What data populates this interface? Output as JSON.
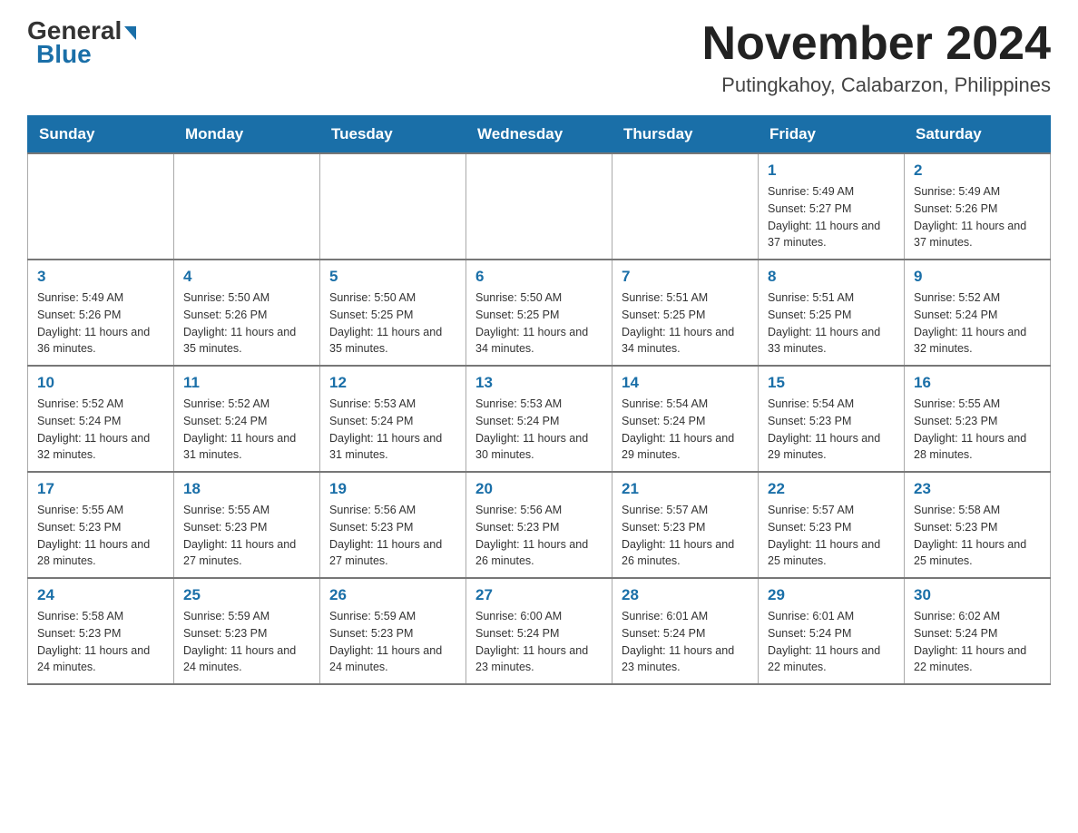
{
  "header": {
    "logo_general": "General",
    "logo_blue": "Blue",
    "month_title": "November 2024",
    "location": "Putingkahoy, Calabarzon, Philippines"
  },
  "days_of_week": [
    "Sunday",
    "Monday",
    "Tuesday",
    "Wednesday",
    "Thursday",
    "Friday",
    "Saturday"
  ],
  "weeks": [
    [
      {
        "day": "",
        "info": ""
      },
      {
        "day": "",
        "info": ""
      },
      {
        "day": "",
        "info": ""
      },
      {
        "day": "",
        "info": ""
      },
      {
        "day": "",
        "info": ""
      },
      {
        "day": "1",
        "info": "Sunrise: 5:49 AM\nSunset: 5:27 PM\nDaylight: 11 hours and 37 minutes."
      },
      {
        "day": "2",
        "info": "Sunrise: 5:49 AM\nSunset: 5:26 PM\nDaylight: 11 hours and 37 minutes."
      }
    ],
    [
      {
        "day": "3",
        "info": "Sunrise: 5:49 AM\nSunset: 5:26 PM\nDaylight: 11 hours and 36 minutes."
      },
      {
        "day": "4",
        "info": "Sunrise: 5:50 AM\nSunset: 5:26 PM\nDaylight: 11 hours and 35 minutes."
      },
      {
        "day": "5",
        "info": "Sunrise: 5:50 AM\nSunset: 5:25 PM\nDaylight: 11 hours and 35 minutes."
      },
      {
        "day": "6",
        "info": "Sunrise: 5:50 AM\nSunset: 5:25 PM\nDaylight: 11 hours and 34 minutes."
      },
      {
        "day": "7",
        "info": "Sunrise: 5:51 AM\nSunset: 5:25 PM\nDaylight: 11 hours and 34 minutes."
      },
      {
        "day": "8",
        "info": "Sunrise: 5:51 AM\nSunset: 5:25 PM\nDaylight: 11 hours and 33 minutes."
      },
      {
        "day": "9",
        "info": "Sunrise: 5:52 AM\nSunset: 5:24 PM\nDaylight: 11 hours and 32 minutes."
      }
    ],
    [
      {
        "day": "10",
        "info": "Sunrise: 5:52 AM\nSunset: 5:24 PM\nDaylight: 11 hours and 32 minutes."
      },
      {
        "day": "11",
        "info": "Sunrise: 5:52 AM\nSunset: 5:24 PM\nDaylight: 11 hours and 31 minutes."
      },
      {
        "day": "12",
        "info": "Sunrise: 5:53 AM\nSunset: 5:24 PM\nDaylight: 11 hours and 31 minutes."
      },
      {
        "day": "13",
        "info": "Sunrise: 5:53 AM\nSunset: 5:24 PM\nDaylight: 11 hours and 30 minutes."
      },
      {
        "day": "14",
        "info": "Sunrise: 5:54 AM\nSunset: 5:24 PM\nDaylight: 11 hours and 29 minutes."
      },
      {
        "day": "15",
        "info": "Sunrise: 5:54 AM\nSunset: 5:23 PM\nDaylight: 11 hours and 29 minutes."
      },
      {
        "day": "16",
        "info": "Sunrise: 5:55 AM\nSunset: 5:23 PM\nDaylight: 11 hours and 28 minutes."
      }
    ],
    [
      {
        "day": "17",
        "info": "Sunrise: 5:55 AM\nSunset: 5:23 PM\nDaylight: 11 hours and 28 minutes."
      },
      {
        "day": "18",
        "info": "Sunrise: 5:55 AM\nSunset: 5:23 PM\nDaylight: 11 hours and 27 minutes."
      },
      {
        "day": "19",
        "info": "Sunrise: 5:56 AM\nSunset: 5:23 PM\nDaylight: 11 hours and 27 minutes."
      },
      {
        "day": "20",
        "info": "Sunrise: 5:56 AM\nSunset: 5:23 PM\nDaylight: 11 hours and 26 minutes."
      },
      {
        "day": "21",
        "info": "Sunrise: 5:57 AM\nSunset: 5:23 PM\nDaylight: 11 hours and 26 minutes."
      },
      {
        "day": "22",
        "info": "Sunrise: 5:57 AM\nSunset: 5:23 PM\nDaylight: 11 hours and 25 minutes."
      },
      {
        "day": "23",
        "info": "Sunrise: 5:58 AM\nSunset: 5:23 PM\nDaylight: 11 hours and 25 minutes."
      }
    ],
    [
      {
        "day": "24",
        "info": "Sunrise: 5:58 AM\nSunset: 5:23 PM\nDaylight: 11 hours and 24 minutes."
      },
      {
        "day": "25",
        "info": "Sunrise: 5:59 AM\nSunset: 5:23 PM\nDaylight: 11 hours and 24 minutes."
      },
      {
        "day": "26",
        "info": "Sunrise: 5:59 AM\nSunset: 5:23 PM\nDaylight: 11 hours and 24 minutes."
      },
      {
        "day": "27",
        "info": "Sunrise: 6:00 AM\nSunset: 5:24 PM\nDaylight: 11 hours and 23 minutes."
      },
      {
        "day": "28",
        "info": "Sunrise: 6:01 AM\nSunset: 5:24 PM\nDaylight: 11 hours and 23 minutes."
      },
      {
        "day": "29",
        "info": "Sunrise: 6:01 AM\nSunset: 5:24 PM\nDaylight: 11 hours and 22 minutes."
      },
      {
        "day": "30",
        "info": "Sunrise: 6:02 AM\nSunset: 5:24 PM\nDaylight: 11 hours and 22 minutes."
      }
    ]
  ]
}
